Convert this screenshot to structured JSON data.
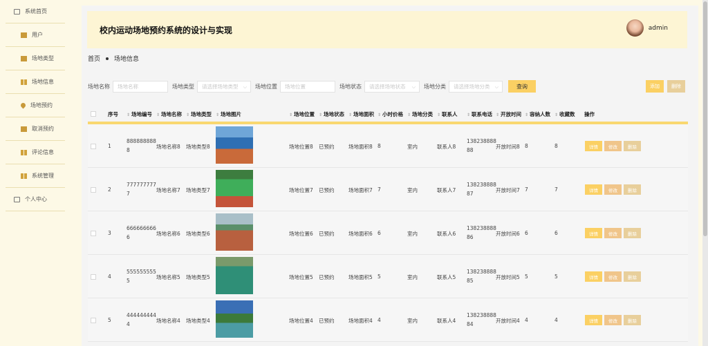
{
  "sidebar": {
    "items": [
      {
        "label": "系统首页",
        "icon": "home-icon"
      },
      {
        "label": "用户",
        "icon": "user-icon"
      },
      {
        "label": "场地类型",
        "icon": "card-icon"
      },
      {
        "label": "场地信息",
        "icon": "grid-icon"
      },
      {
        "label": "场地预约",
        "icon": "pin-icon"
      },
      {
        "label": "取消预约",
        "icon": "card-icon"
      },
      {
        "label": "评论信息",
        "icon": "grid-icon"
      },
      {
        "label": "系统管理",
        "icon": "grid-icon"
      },
      {
        "label": "个人中心",
        "icon": "profile-icon"
      }
    ]
  },
  "header": {
    "title": "校内运动场地预约系统的设计与实现",
    "username": "admin"
  },
  "breadcrumb": {
    "home": "首页",
    "current": "场地信息"
  },
  "filters": {
    "name_label": "场地名称",
    "name_placeholder": "场地名称",
    "type_label": "场地类型",
    "type_placeholder": "请选择场地类型",
    "loc_label": "场地位置",
    "loc_placeholder": "场地位置",
    "status_label": "场地状态",
    "status_placeholder": "请选择场地状态",
    "cat_label": "场地分类",
    "cat_placeholder": "请选择场地分类",
    "query": "查询"
  },
  "toolbar": {
    "add": "添加",
    "delete": "删除"
  },
  "table": {
    "headers": [
      "序号",
      "场地编号",
      "场地名称",
      "场地类型",
      "场地图片",
      "场地位置",
      "场地状态",
      "场地面积",
      "小时价格",
      "场地分类",
      "联系人",
      "联系电话",
      "开放时间",
      "容纳人数",
      "收藏数",
      "操作"
    ],
    "actions": {
      "detail": "详情",
      "edit": "修改",
      "delete": "删除"
    },
    "rows": [
      {
        "idx": "1",
        "code1": "888888888",
        "code2": "8",
        "name": "场地名称8",
        "type": "场地类型8",
        "loc": "场地位置8",
        "status": "已预约",
        "area": "场地面积8",
        "price": "8",
        "cat": "室内",
        "contact": "联系人8",
        "phone1": "138238888",
        "phone2": "88",
        "open": "开放时间8",
        "cap": "8",
        "fav": "8",
        "pic": "court-blue"
      },
      {
        "idx": "2",
        "code1": "777777777",
        "code2": "7",
        "name": "场地名称7",
        "type": "场地类型7",
        "loc": "场地位置7",
        "status": "已预约",
        "area": "场地面积7",
        "price": "7",
        "cat": "室内",
        "contact": "联系人7",
        "phone1": "138238888",
        "phone2": "87",
        "open": "开放时间7",
        "cap": "7",
        "fav": "7",
        "pic": "court-green"
      },
      {
        "idx": "3",
        "code1": "666666666",
        "code2": "6",
        "name": "场地名称6",
        "type": "场地类型6",
        "loc": "场地位置6",
        "status": "已预约",
        "area": "场地面积6",
        "price": "6",
        "cat": "室内",
        "contact": "联系人6",
        "phone1": "138238888",
        "phone2": "86",
        "open": "开放时间6",
        "cap": "6",
        "fav": "6",
        "pic": "court-red"
      },
      {
        "idx": "4",
        "code1": "555555555",
        "code2": "5",
        "name": "场地名称5",
        "type": "场地类型5",
        "loc": "场地位置5",
        "status": "已预约",
        "area": "场地面积5",
        "price": "5",
        "cat": "室内",
        "contact": "联系人5",
        "phone1": "138238888",
        "phone2": "85",
        "open": "开放时间5",
        "cap": "5",
        "fav": "5",
        "pic": "court-teal"
      },
      {
        "idx": "5",
        "code1": "444444444",
        "code2": "4",
        "name": "场地名称4",
        "type": "场地类型4",
        "loc": "场地位置4",
        "status": "已预约",
        "area": "场地面积4",
        "price": "4",
        "cat": "室内",
        "contact": "联系人4",
        "phone1": "138238888",
        "phone2": "84",
        "open": "开放时间4",
        "cap": "4",
        "fav": "4",
        "pic": "court-park"
      }
    ]
  },
  "colors": {
    "accent": "#fbd063",
    "edit": "#f0c58a",
    "delete": "#e8cf9b",
    "sidebar_bg": "#fdf9e6"
  }
}
